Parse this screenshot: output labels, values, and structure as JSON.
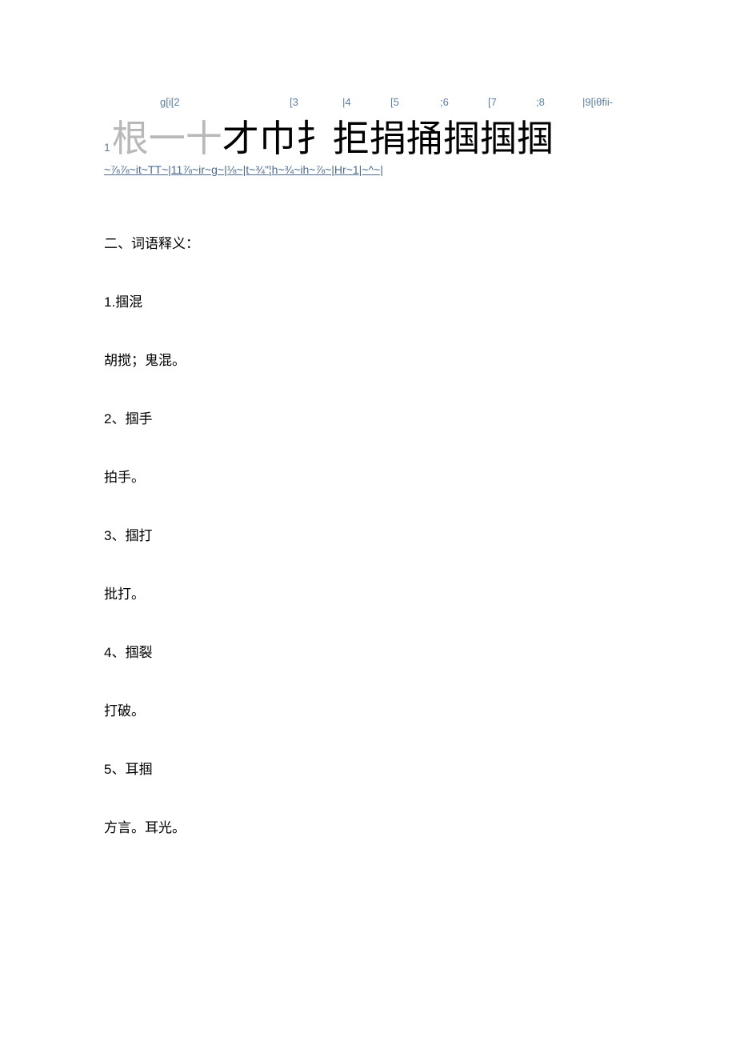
{
  "annotations": {
    "a1": "g[i[2",
    "a2": "[3",
    "a3": "|4",
    "a4": "[5",
    "a5": ";6",
    "a6": "[7",
    "a7": ";8",
    "a8": "|9[iθfii-"
  },
  "largeLine": {
    "idx": "1",
    "grayPart": "根一十",
    "blackPart": "才巾扌拒捐捅掴掴掴"
  },
  "phonetic": "~⅞⅞~it~TT~|11⅞~ir~g~|⅛~|t~¾\"¦h~¾~ih~⅞~|Hr~1|~^~|",
  "sectionTitle": "二、词语释义：",
  "terms": [
    {
      "label": "1.掴混",
      "def": "胡搅；鬼混。"
    },
    {
      "label": "2、掴手",
      "def": "拍手。"
    },
    {
      "label": "3、掴打",
      "def": "批打。"
    },
    {
      "label": "4、掴裂",
      "def": "打破。"
    },
    {
      "label": "5、耳掴",
      "def": "方言。耳光。"
    }
  ]
}
